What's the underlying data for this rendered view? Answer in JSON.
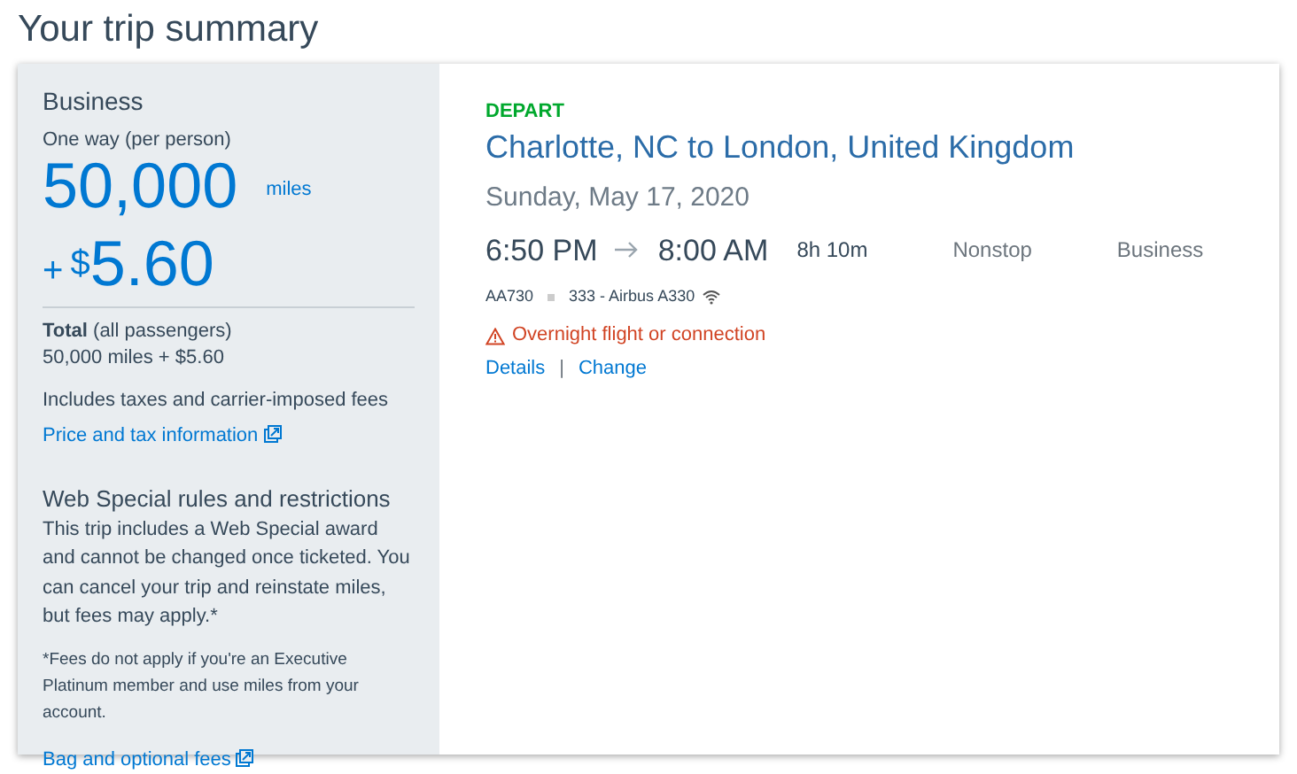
{
  "page_title": "Your trip summary",
  "price": {
    "cabin": "Business",
    "trip_type": "One way (per person)",
    "miles": "50,000",
    "miles_unit": "miles",
    "plus": "+",
    "currency": "$",
    "amount": "5.60",
    "total_label": "**Total** (all passengers)",
    "total_value": "50,000 miles + $5.60",
    "fees_note": "Includes taxes and carrier-imposed fees",
    "price_link": "Price and tax information"
  },
  "rules": {
    "heading": "Web Special rules and restrictions",
    "body": "This trip includes a Web Special award and cannot be changed once ticketed. You can cancel your trip and reinstate miles, but fees may apply.*",
    "footnote": "*Fees do not apply if you're an Executive Platinum member and use miles from your account.",
    "bag_link": "Bag and optional fees"
  },
  "flight": {
    "direction": "DEPART",
    "route": "Charlotte, NC to London, United Kingdom",
    "date": "Sunday, May 17, 2020",
    "depart_time": "6:50 PM",
    "arrive_time": "8:00 AM",
    "duration": "8h 10m",
    "stops": "Nonstop",
    "cabin": "Business",
    "flight_number": "AA730",
    "aircraft": "333 - Airbus A330",
    "wifi": true,
    "warning": "Overnight flight or connection",
    "links": [
      "Details",
      "Change"
    ],
    "link_separator": "|"
  }
}
